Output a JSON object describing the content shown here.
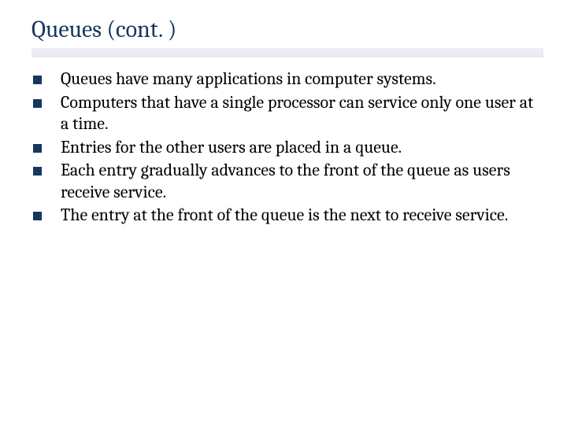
{
  "title": "Queues (cont. )",
  "bullets": [
    "Queues have many applications in computer systems.",
    "Computers that have a single processor can service only one user at a time.",
    "Entries for the other users are placed in a queue.",
    "Each entry gradually advances to the front of the queue as users receive service.",
    "The entry at the front of the queue is the next to receive service."
  ]
}
